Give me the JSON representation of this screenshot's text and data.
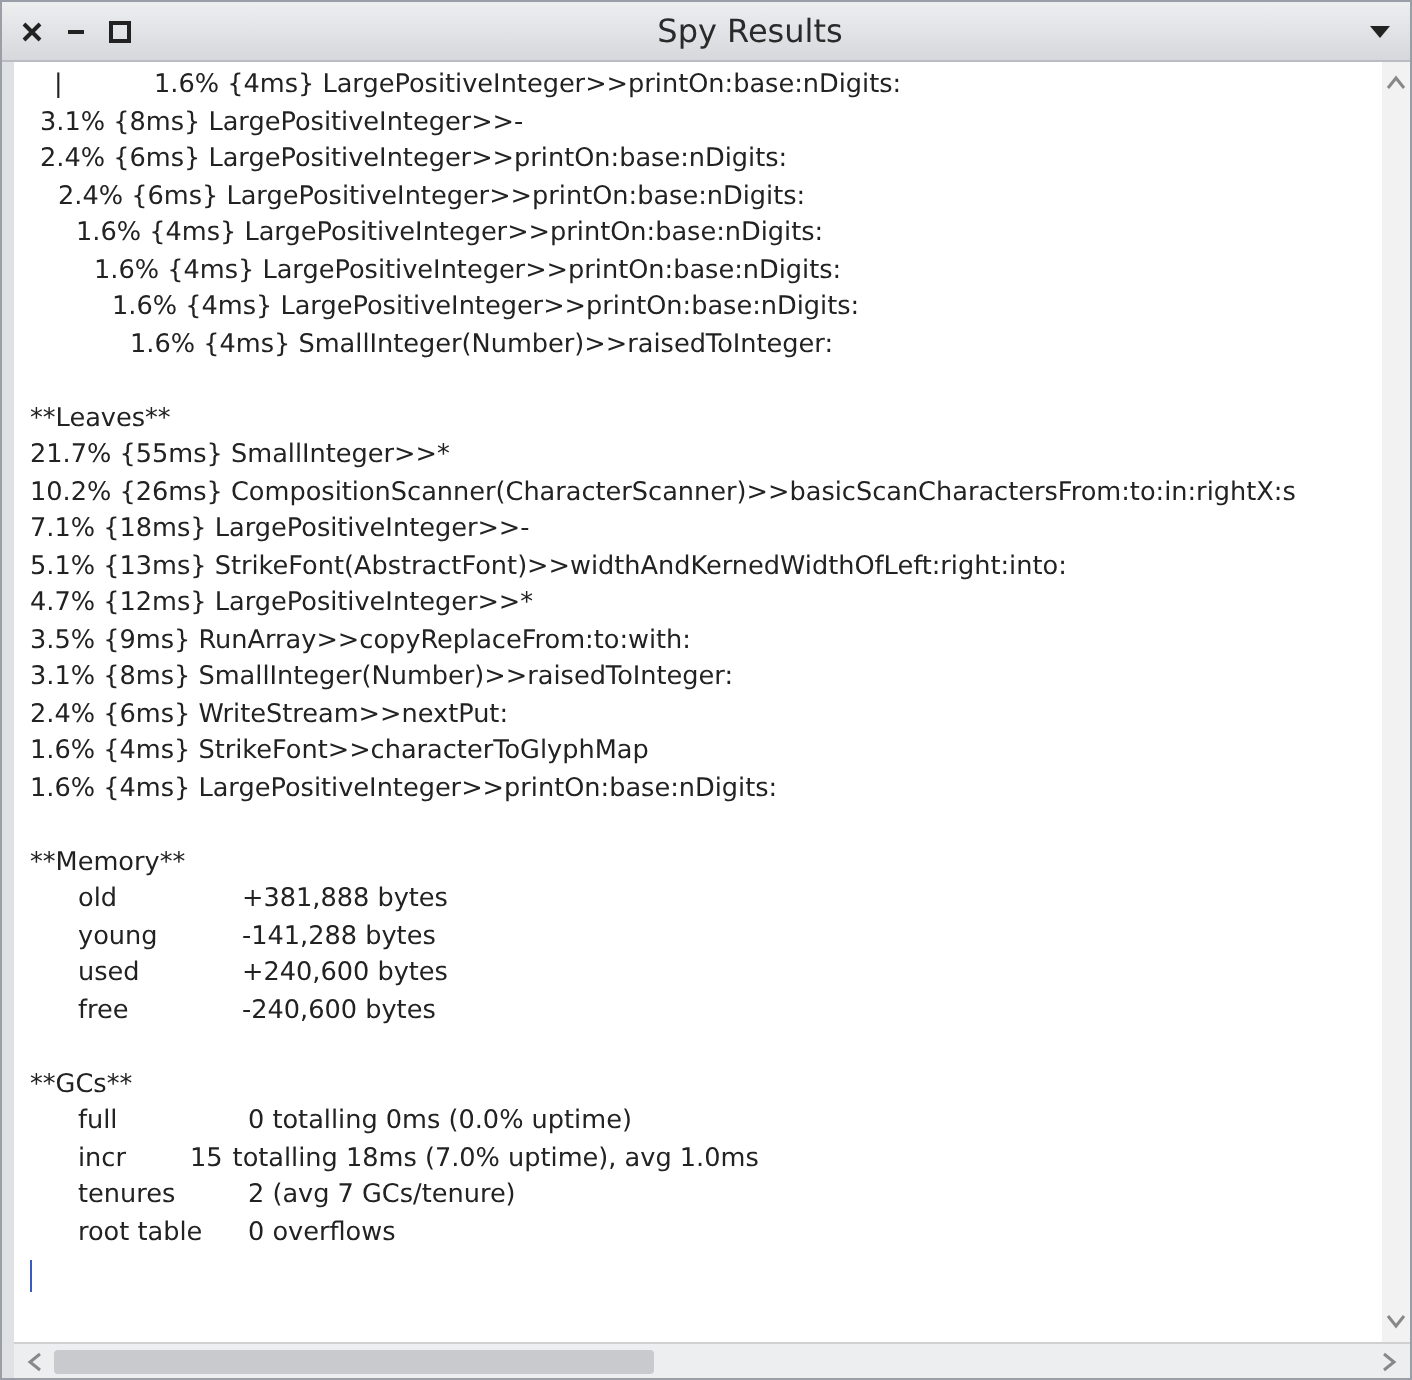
{
  "window": {
    "title": "Spy Results"
  },
  "tally": {
    "continuation": {
      "marker": "|",
      "text": "1.6% {4ms} LargePositiveInteger>>printOn:base:nDigits:"
    },
    "tree": [
      {
        "text": "3.1% {8ms} LargePositiveInteger>>-"
      },
      {
        "text": "2.4% {6ms} LargePositiveInteger>>printOn:base:nDigits:",
        "children": [
          {
            "text": "2.4% {6ms} LargePositiveInteger>>printOn:base:nDigits:",
            "children": [
              {
                "text": "1.6% {4ms} LargePositiveInteger>>printOn:base:nDigits:",
                "children": [
                  {
                    "text": "1.6% {4ms} LargePositiveInteger>>printOn:base:nDigits:",
                    "children": [
                      {
                        "text": "1.6% {4ms} LargePositiveInteger>>printOn:base:nDigits:",
                        "children": [
                          {
                            "text": "1.6% {4ms} SmallInteger(Number)>>raisedToInteger:"
                          }
                        ]
                      }
                    ]
                  }
                ]
              }
            ]
          }
        ]
      }
    ]
  },
  "leaves": {
    "heading": "**Leaves**",
    "lines": [
      "21.7% {55ms} SmallInteger>>*",
      "10.2% {26ms} CompositionScanner(CharacterScanner)>>basicScanCharactersFrom:to:in:rightX:s",
      "7.1% {18ms} LargePositiveInteger>>-",
      "5.1% {13ms} StrikeFont(AbstractFont)>>widthAndKernedWidthOfLeft:right:into:",
      "4.7% {12ms} LargePositiveInteger>>*",
      "3.5% {9ms} RunArray>>copyReplaceFrom:to:with:",
      "3.1% {8ms} SmallInteger(Number)>>raisedToInteger:",
      "2.4% {6ms} WriteStream>>nextPut:",
      "1.6% {4ms} StrikeFont>>characterToGlyphMap",
      "1.6% {4ms} LargePositiveInteger>>printOn:base:nDigits:"
    ]
  },
  "memory": {
    "heading": "**Memory**",
    "rows": [
      {
        "label": "old",
        "value": "+381,888 bytes"
      },
      {
        "label": "young",
        "value": "-141,288 bytes"
      },
      {
        "label": "used",
        "value": "+240,600 bytes"
      },
      {
        "label": "free",
        "value": "-240,600 bytes"
      }
    ]
  },
  "gcs": {
    "heading": "**GCs**",
    "rows": [
      {
        "label": "full",
        "value": "0 totalling 0ms (0.0% uptime)"
      },
      {
        "label": "incr",
        "count": "15",
        "value": "totalling 18ms (7.0% uptime), avg 1.0ms"
      },
      {
        "label": "tenures",
        "value": "2 (avg 7 GCs/tenure)"
      },
      {
        "label": "root table",
        "value": "0 overflows"
      }
    ]
  }
}
